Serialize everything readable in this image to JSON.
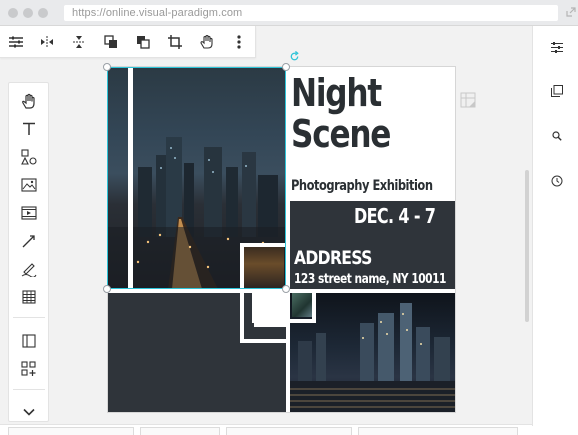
{
  "browser": {
    "url": "https://online.visual-paradigm.com"
  },
  "poster": {
    "title_line1": "Night",
    "title_line2": "Scene",
    "subtitle": "Photography Exhibition",
    "date": "DEC. 4 - 7",
    "address_label": "ADDRESS",
    "address": "123 street name, NY 10011"
  },
  "top_toolbar": {
    "items": [
      "sliders-icon",
      "flip-horizontal-icon",
      "flip-vertical-icon",
      "bring-forward-icon",
      "send-backward-icon",
      "crop-icon",
      "hand-pan-icon",
      "more-icon"
    ]
  },
  "left_toolbar": {
    "items": [
      "hand-icon",
      "text-icon",
      "shapes-icon",
      "image-icon",
      "media-icon",
      "line-icon",
      "draw-icon",
      "table-icon",
      "panel-icon",
      "add-grid-icon",
      "chevron-down-icon"
    ]
  },
  "right_panel": {
    "items": [
      "properties-icon",
      "layers-icon",
      "search-icon",
      "history-icon"
    ]
  },
  "colors": {
    "selection": "#2ec4d8",
    "poster_dark": "#2f343a",
    "poster_text": "#2a2f33"
  }
}
